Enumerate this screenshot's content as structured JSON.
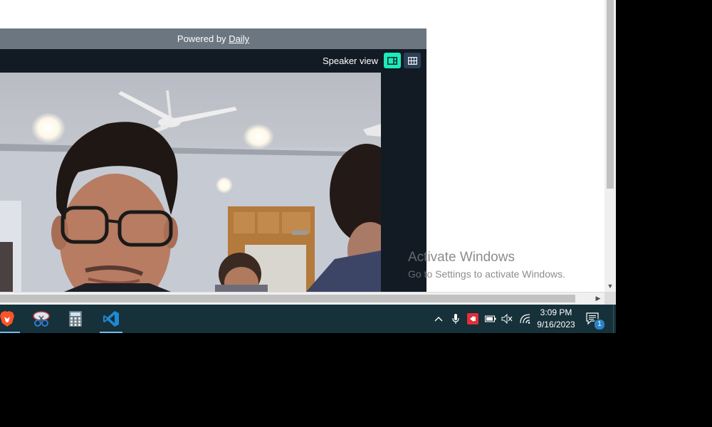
{
  "call": {
    "powered_prefix": "Powered by",
    "powered_brand": "Daily",
    "view_label": "Speaker view",
    "accent": "#1bebb9"
  },
  "watermark": {
    "title": "Activate Windows",
    "subtitle": "Go to Settings to activate Windows."
  },
  "taskbar": {
    "apps": [
      "brave-browser",
      "snipping-tool",
      "calculator",
      "visual-studio-code"
    ],
    "active_app": "visual-studio-code",
    "clock": {
      "time": "3:09 PM",
      "date": "9/16/2023"
    },
    "notifications_count": "1"
  }
}
